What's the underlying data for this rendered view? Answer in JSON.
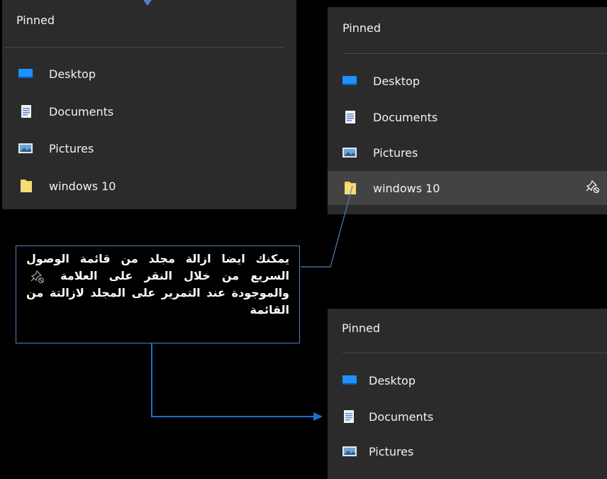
{
  "panels": {
    "left": {
      "title": "Pinned",
      "items": [
        {
          "label": "Desktop",
          "icon": "desktop-icon"
        },
        {
          "label": "Documents",
          "icon": "documents-icon"
        },
        {
          "label": "Pictures",
          "icon": "pictures-icon"
        },
        {
          "label": "windows 10",
          "icon": "folder-icon"
        }
      ]
    },
    "right_top": {
      "title": "Pinned",
      "items": [
        {
          "label": "Desktop",
          "icon": "desktop-icon"
        },
        {
          "label": "Documents",
          "icon": "documents-icon"
        },
        {
          "label": "Pictures",
          "icon": "pictures-icon"
        },
        {
          "label": "windows 10",
          "icon": "folder-icon",
          "hovered": true,
          "action_icon": "unpin-icon"
        }
      ]
    },
    "right_bottom": {
      "title": "Pinned",
      "items": [
        {
          "label": "Desktop",
          "icon": "desktop-icon"
        },
        {
          "label": "Documents",
          "icon": "documents-icon"
        },
        {
          "label": "Pictures",
          "icon": "pictures-icon"
        }
      ]
    }
  },
  "callout": {
    "text_before_icon": "يمكنك ايضا ازالة مجلد من قائمة الوصول السريع من خلال النقر على العلامة",
    "text_after_icon": "والموجودة عند التمرير على المجلد لازالتة من القائمة",
    "icon": "unpin-icon"
  },
  "colors": {
    "panel_bg": "#2b2b2b",
    "hover_bg": "#434343",
    "divider": "#4a4a4a",
    "connector": "#4f81bd",
    "folder": "#f4d35e",
    "desktop": "#1e90ff"
  }
}
